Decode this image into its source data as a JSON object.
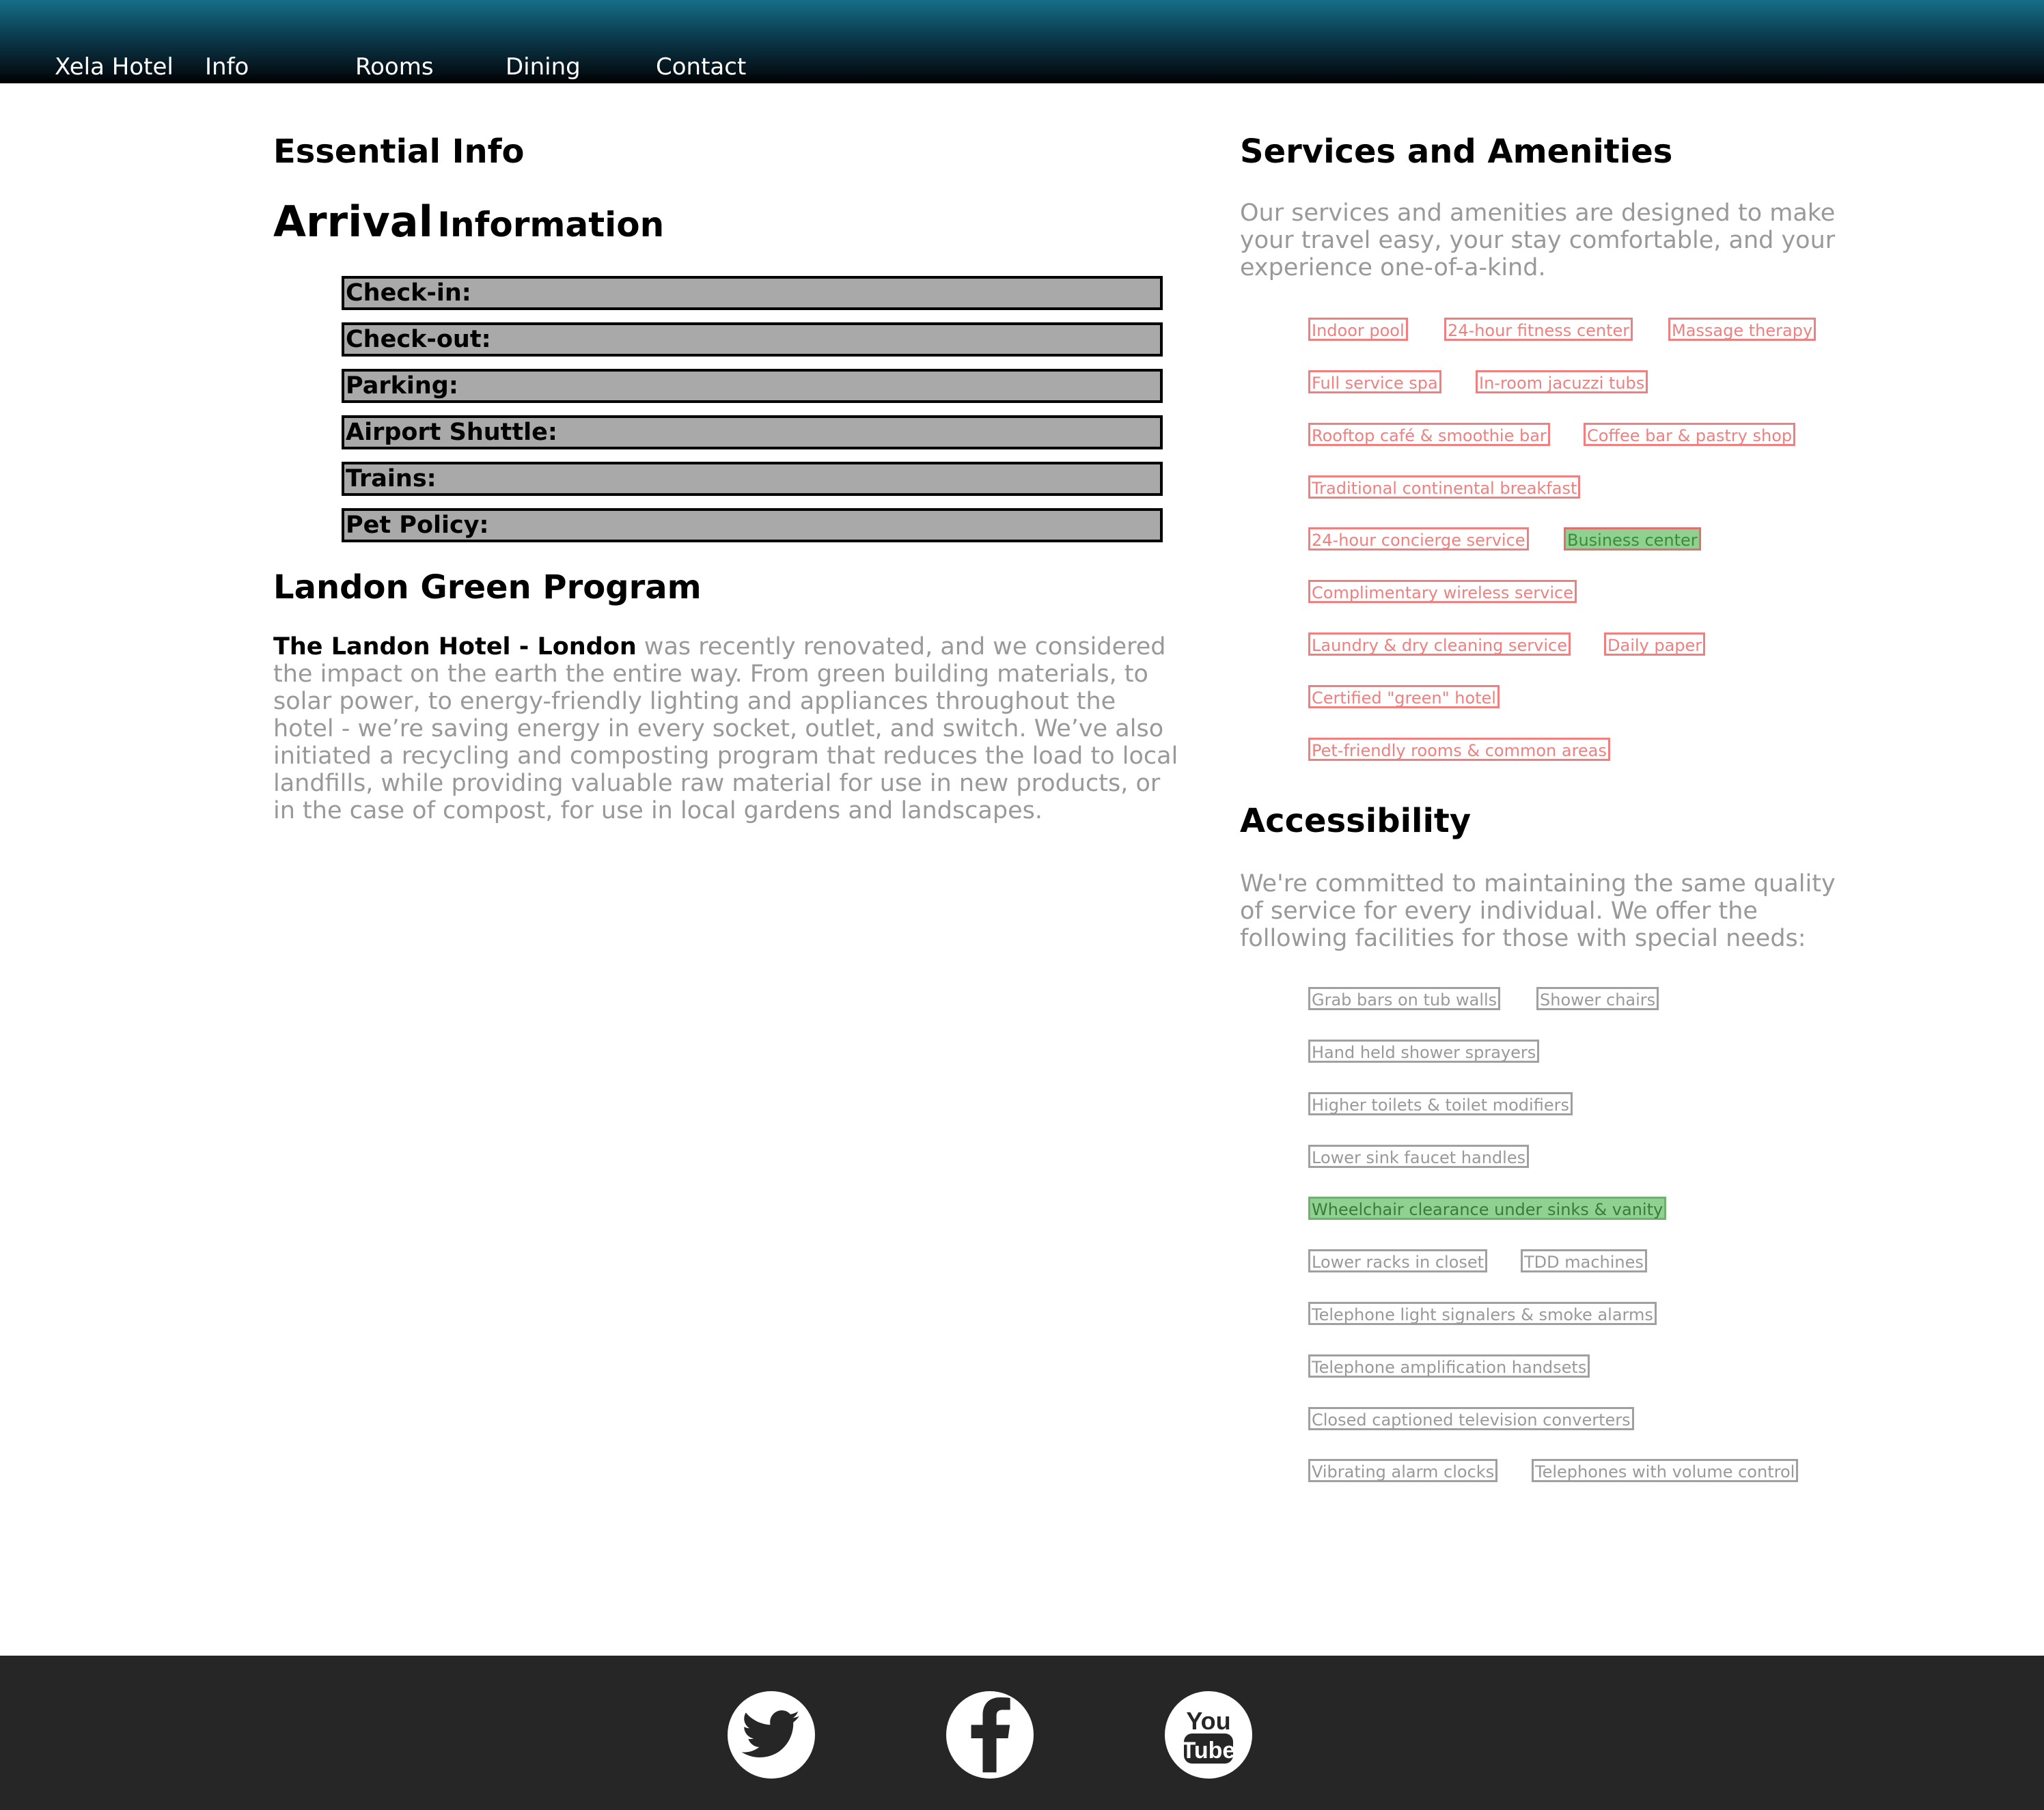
{
  "nav": {
    "brand": "Xela Hotel",
    "items": [
      "Info",
      "Rooms",
      "Dining",
      "Contact"
    ]
  },
  "essential": {
    "title": "Essential Info",
    "arrival_big": "Arrival",
    "arrival_small": "Information",
    "rows": [
      "Check-in:",
      "Check-out:",
      "Parking:",
      "Airport Shuttle:",
      "Trains:",
      "Pet Policy:"
    ]
  },
  "green": {
    "title": "Landon Green Program",
    "lead": "The Landon Hotel - London",
    "body": " was recently renovated, and we considered the impact on the earth the entire way. From green building materials, to solar power, to energy-friendly lighting and appliances throughout the hotel - we’re saving energy in every socket, outlet, and switch. We’ve also initiated a recycling and composting program that reduces the load to local landfills, while providing valuable raw material for use in new products, or in the case of compost, for use in local gardens and landscapes."
  },
  "services": {
    "title": "Services and Amenities",
    "intro": "Our services and amenities are designed to make your travel easy, your stay comfortable, and your experience one-of-a-kind.",
    "items": [
      "Indoor pool",
      "24-hour fitness center",
      "Massage therapy",
      "Full service spa",
      "In-room jacuzzi tubs",
      "Rooftop café & smoothie bar",
      "Coffee bar & pastry shop",
      "Traditional continental breakfast",
      "24-hour concierge service",
      "Business center",
      "Complimentary wireless service",
      "Laundry & dry cleaning service",
      "Daily paper",
      "Certified \"green\" hotel",
      "Pet-friendly rooms & common areas"
    ],
    "highlighted": "Business center"
  },
  "accessibility": {
    "title": "Accessibility",
    "intro": "We're committed to maintaining the same quality of service for every individual. We offer the following facilities for those with special needs:",
    "items": [
      "Grab bars on tub walls",
      "Shower chairs",
      "Hand held shower sprayers",
      "Higher toilets & toilet modifiers",
      "Lower sink faucet handles",
      "Wheelchair clearance under sinks & vanity",
      "Lower racks in closet",
      "TDD machines",
      "Telephone light signalers & smoke alarms",
      "Telephone amplification handsets",
      "Closed captioned television converters",
      "Vibrating alarm clocks",
      "Telephones with volume control"
    ],
    "highlighted": "Wheelchair clearance under sinks & vanity"
  },
  "footer": {
    "icons": [
      "twitter-icon",
      "facebook-icon",
      "youtube-icon"
    ],
    "youtube_top": "You",
    "youtube_bottom": "Tube"
  },
  "colors": {
    "header_top": "#156f88",
    "header_bottom": "#000000",
    "footer_bg": "#262626",
    "service_tag": "#f08080",
    "access_tag": "#a0a0a0",
    "highlight_bg": "#90d090",
    "info_bar_bg": "#a9a9a9"
  }
}
